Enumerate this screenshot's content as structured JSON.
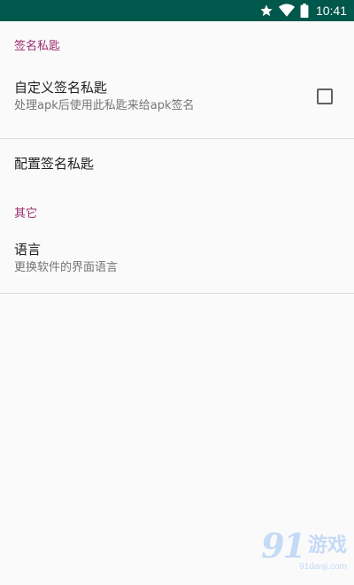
{
  "status_bar": {
    "time": "10:41",
    "icons": [
      "star-icon",
      "wifi-icon",
      "battery-icon"
    ],
    "background": "#00574b"
  },
  "sections": [
    {
      "header": "签名私匙",
      "items": [
        {
          "title": "自定义签名私匙",
          "summary": "处理apk后使用此私匙来给apk签名",
          "checked": false
        },
        {
          "title": "配置签名私匙"
        }
      ]
    },
    {
      "header": "其它",
      "items": [
        {
          "title": "语言",
          "summary": "更换软件的界面语言"
        }
      ]
    }
  ],
  "watermark": {
    "digits": "91",
    "brand": "游戏",
    "url": "91danji.com"
  },
  "colors": {
    "accent": "#9c2a6e",
    "text_primary": "#212121",
    "text_secondary": "#757575"
  }
}
